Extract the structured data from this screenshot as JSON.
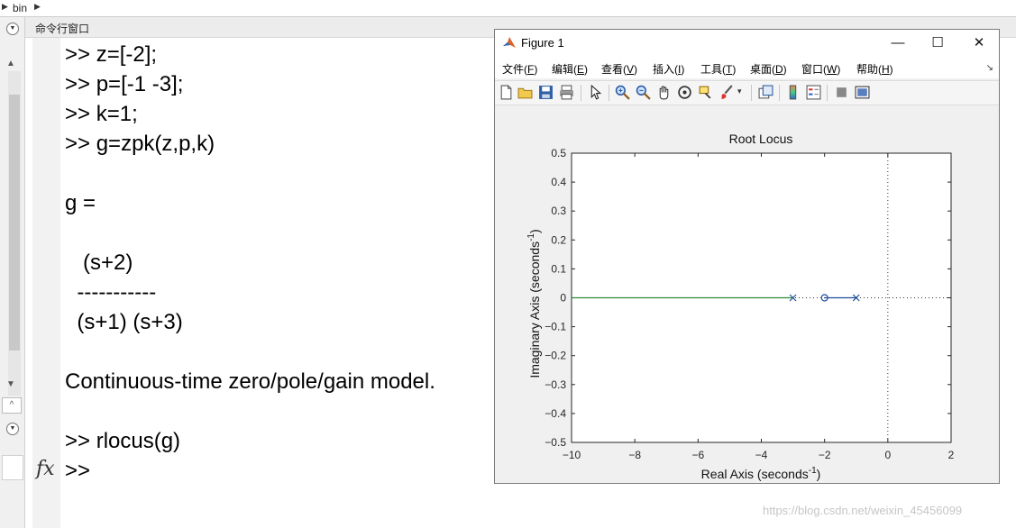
{
  "path_bar": {
    "crumb": "bin"
  },
  "command_window": {
    "title": "命令行窗口",
    "lines": [
      ">> z=[-2];",
      ">> p=[-1 -3];",
      ">> k=1;",
      ">> g=zpk(z,p,k)",
      "",
      "g =",
      "",
      "   (s+2)",
      "  -----------",
      "  (s+1) (s+3)",
      "",
      "Continuous-time zero/pole/gain model.",
      "",
      ">> rlocus(g)",
      ">> "
    ],
    "fx_label": "fx"
  },
  "figure": {
    "title": "Figure 1",
    "menus": [
      {
        "text": "文件(",
        "acc": "F",
        "tail": ")"
      },
      {
        "text": "编辑(",
        "acc": "E",
        "tail": ")"
      },
      {
        "text": "查看(",
        "acc": "V",
        "tail": ")"
      },
      {
        "text": "插入(",
        "acc": "I",
        "tail": ")"
      },
      {
        "text": "工具(",
        "acc": "T",
        "tail": ")"
      },
      {
        "text": "桌面(",
        "acc": "D",
        "tail": ")"
      },
      {
        "text": "窗口(",
        "acc": "W",
        "tail": ")"
      },
      {
        "text": "帮助(",
        "acc": "H",
        "tail": ")"
      }
    ],
    "toolbar_icons": [
      "new-figure-icon",
      "open-icon",
      "save-icon",
      "print-icon",
      "pointer-icon",
      "zoom-in-icon",
      "zoom-out-icon",
      "pan-icon",
      "rotate-icon",
      "data-cursor-icon",
      "brush-icon",
      "link-plot-icon",
      "colorbar-icon",
      "legend-icon",
      "hide-tools-icon",
      "dock-icon"
    ]
  },
  "chart_data": {
    "type": "line",
    "title": "Root Locus",
    "xlabel": "Real Axis (seconds",
    "xlabel_sup": "-1",
    "xlabel_close": ")",
    "ylabel": "Imaginary Axis (seconds",
    "ylabel_sup": "-1",
    "ylabel_close": ")",
    "xlim": [
      -10,
      2
    ],
    "ylim": [
      -0.5,
      0.5
    ],
    "xticks": [
      -10,
      -8,
      -6,
      -4,
      -2,
      0,
      2
    ],
    "yticks": [
      0.5,
      0.4,
      0.3,
      0.2,
      0.1,
      0,
      -0.1,
      -0.2,
      -0.3,
      -0.4,
      -0.5
    ],
    "xtick_labels": [
      "−10",
      "−8",
      "−6",
      "−4",
      "−2",
      "0",
      "2"
    ],
    "ytick_labels": [
      "0.5",
      "0.4",
      "0.3",
      "0.2",
      "0.1",
      "0",
      "−0.1",
      "−0.2",
      "−0.3",
      "−0.4",
      "−0.5"
    ],
    "poles": [
      -1,
      -3
    ],
    "zeros": [
      -2
    ],
    "series": [
      {
        "x": [
          -10,
          -3
        ],
        "y": [
          0,
          0
        ],
        "color": "#2e8b3a"
      },
      {
        "x": [
          -2,
          -1
        ],
        "y": [
          0,
          0
        ],
        "color": "#1f4e9c"
      }
    ],
    "marker_color": "#1f4e9c",
    "grid": false
  },
  "watermark": "https://blog.csdn.net/weixin_45456099"
}
